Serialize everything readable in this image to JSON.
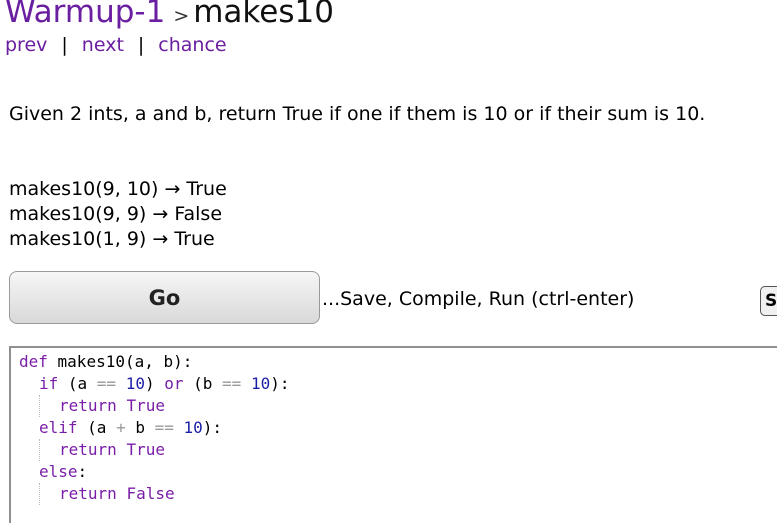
{
  "header": {
    "section": "Warmup-1",
    "separator": ">",
    "problem": "makes10"
  },
  "nav": {
    "prev": "prev",
    "next": "next",
    "chance": "chance",
    "sep": "|"
  },
  "prompt": "Given 2 ints, a and b, return True if one if them is 10 or if their sum is 10.",
  "examples": [
    "makes10(9, 10) → True",
    "makes10(9, 9) → False",
    "makes10(1, 9) → True"
  ],
  "run": {
    "go_label": "Go",
    "save_text": "...Save, Compile, Run (ctrl-enter)",
    "side_button": "S"
  },
  "code": {
    "l1_kw": "def",
    "l1_rest": " makes10(a, b):",
    "l2_if": "if",
    "l2_open": " (a ",
    "l2_eq1": "==",
    "l2_space1": " ",
    "l2_num1": "10",
    "l2_mid": ") ",
    "l2_or": "or",
    "l2_open2": " (b ",
    "l2_eq2": "==",
    "l2_space2": " ",
    "l2_num2": "10",
    "l2_end": "):",
    "l3_return": "return",
    "l3_space": " ",
    "l3_true": "True",
    "l4_elif": "elif",
    "l4_open": " (a ",
    "l4_plus": "+",
    "l4_b": " b ",
    "l4_eq": "==",
    "l4_space": " ",
    "l4_num": "10",
    "l4_end": "):",
    "l5_return": "return",
    "l5_space": " ",
    "l5_true": "True",
    "l6_else": "else",
    "l6_colon": ":",
    "l7_return": "return",
    "l7_space": " ",
    "l7_false": "False"
  }
}
